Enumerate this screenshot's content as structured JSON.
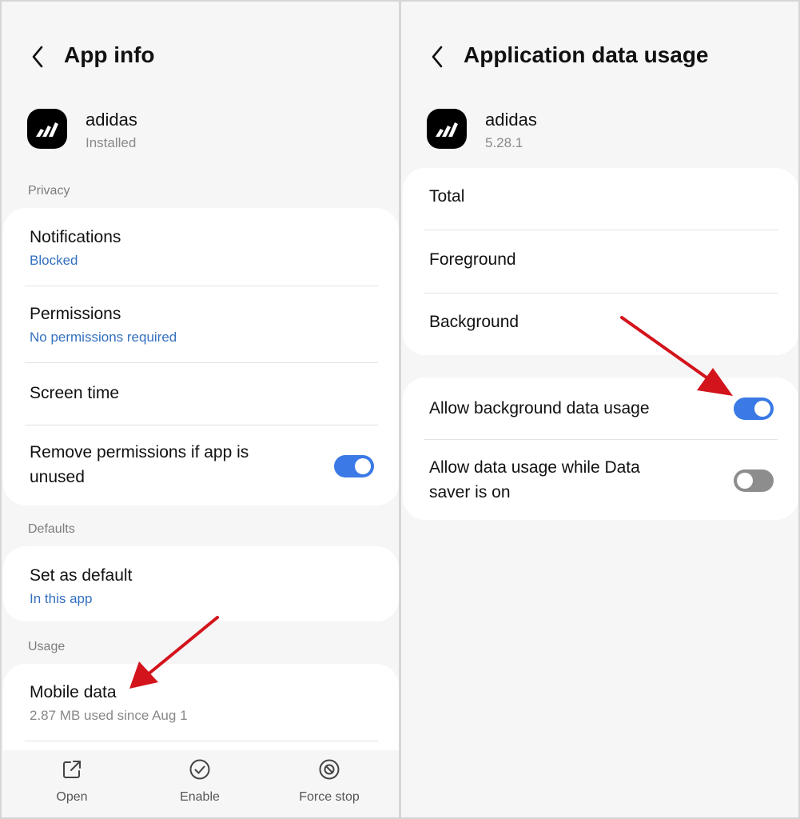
{
  "left": {
    "title": "App info",
    "app": {
      "name": "adidas",
      "status": "Installed"
    },
    "sections": {
      "privacy": "Privacy",
      "defaults": "Defaults",
      "usage": "Usage"
    },
    "privacy_items": {
      "notifications": {
        "title": "Notifications",
        "sub": "Blocked"
      },
      "permissions": {
        "title": "Permissions",
        "sub": "No permissions required"
      },
      "screen_time": {
        "title": "Screen time"
      },
      "remove_permissions": {
        "title_line1": "Remove permissions if app is",
        "title_line2": "unused",
        "enabled": true
      }
    },
    "defaults_items": {
      "set_default": {
        "title": "Set as default",
        "sub": "In this app"
      }
    },
    "usage_items": {
      "mobile_data": {
        "title": "Mobile data",
        "sub": "2.87 MB used since Aug 1"
      }
    },
    "bottom_bar": {
      "open": "Open",
      "enable": "Enable",
      "force_stop": "Force stop"
    }
  },
  "right": {
    "title": "Application data usage",
    "app": {
      "name": "adidas",
      "version": "5.28.1"
    },
    "usage_items": {
      "total": "Total",
      "foreground": "Foreground",
      "background": "Background"
    },
    "settings": {
      "allow_background": {
        "title": "Allow background data usage",
        "enabled": true
      },
      "allow_data_saver": {
        "title_line1": "Allow data usage while Data",
        "title_line2": "saver is on",
        "enabled": false
      }
    }
  },
  "colors": {
    "accent": "#3a79e6",
    "link": "#3470c0",
    "arrow": "#d3141c",
    "background": "#f6f6f6"
  }
}
